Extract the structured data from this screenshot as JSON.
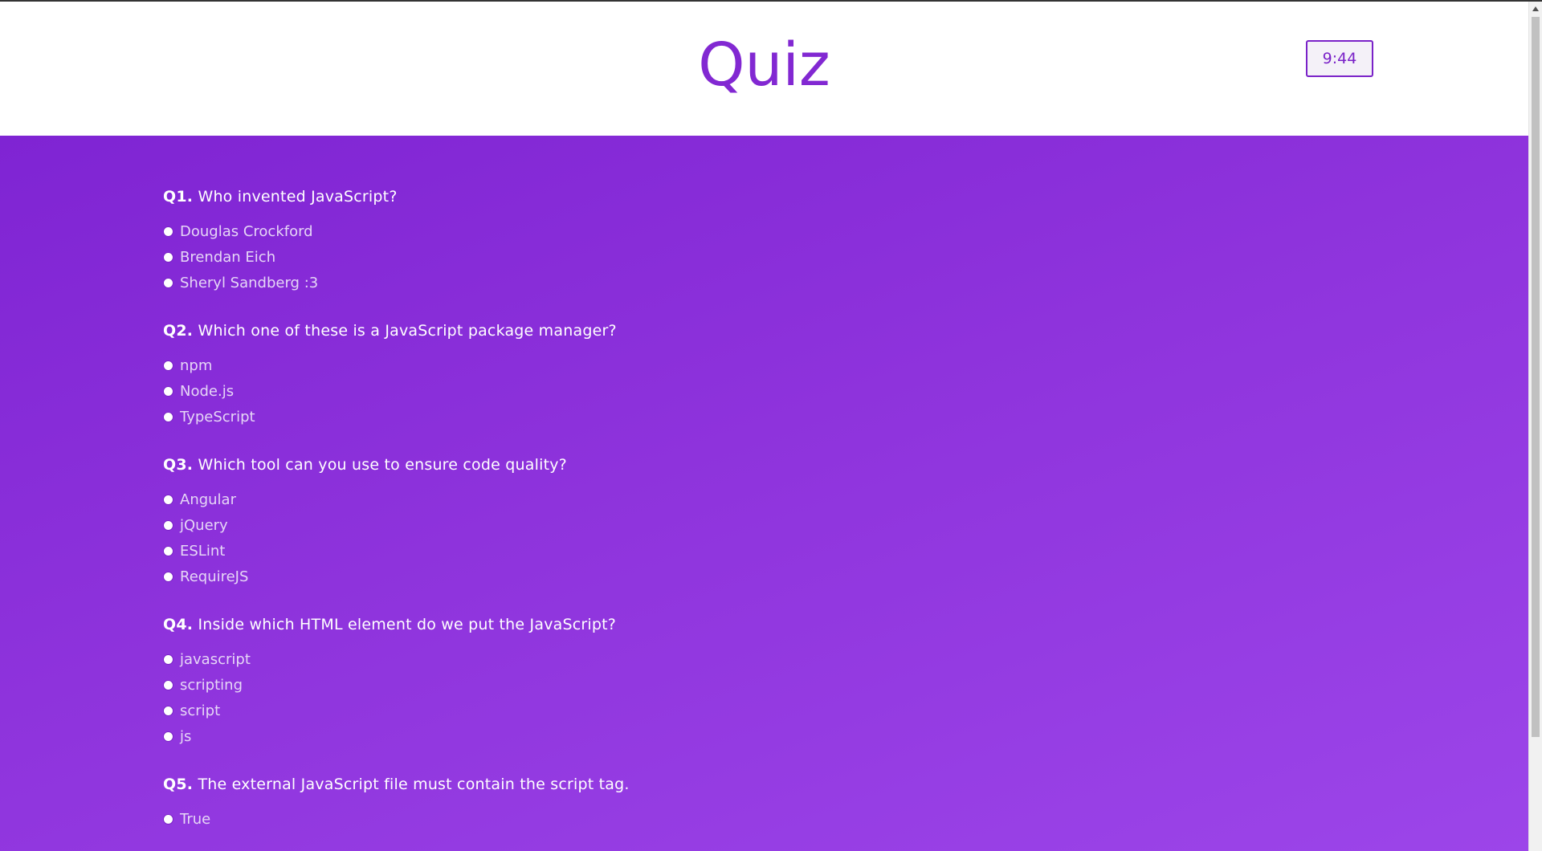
{
  "header": {
    "title": "Quiz",
    "timer": "9:44"
  },
  "questions": [
    {
      "number": "Q1.",
      "text": "Who invented JavaScript?",
      "options": [
        "Douglas Crockford",
        "Brendan Eich",
        "Sheryl Sandberg :3"
      ]
    },
    {
      "number": "Q2.",
      "text": "Which one of these is a JavaScript package manager?",
      "options": [
        "npm",
        "Node.js",
        "TypeScript"
      ]
    },
    {
      "number": "Q3.",
      "text": "Which tool can you use to ensure code quality?",
      "options": [
        "Angular",
        "jQuery",
        "ESLint",
        "RequireJS"
      ]
    },
    {
      "number": "Q4.",
      "text": "Inside which HTML element do we put the JavaScript?",
      "options": [
        "javascript",
        "scripting",
        "script",
        "js"
      ]
    },
    {
      "number": "Q5.",
      "text": "The external JavaScript file must contain the script tag.",
      "options": [
        "True"
      ]
    }
  ],
  "colors": {
    "accent": "#8228d2",
    "background_gradient_start": "#7f24d3",
    "background_gradient_end": "#9c45e9"
  }
}
